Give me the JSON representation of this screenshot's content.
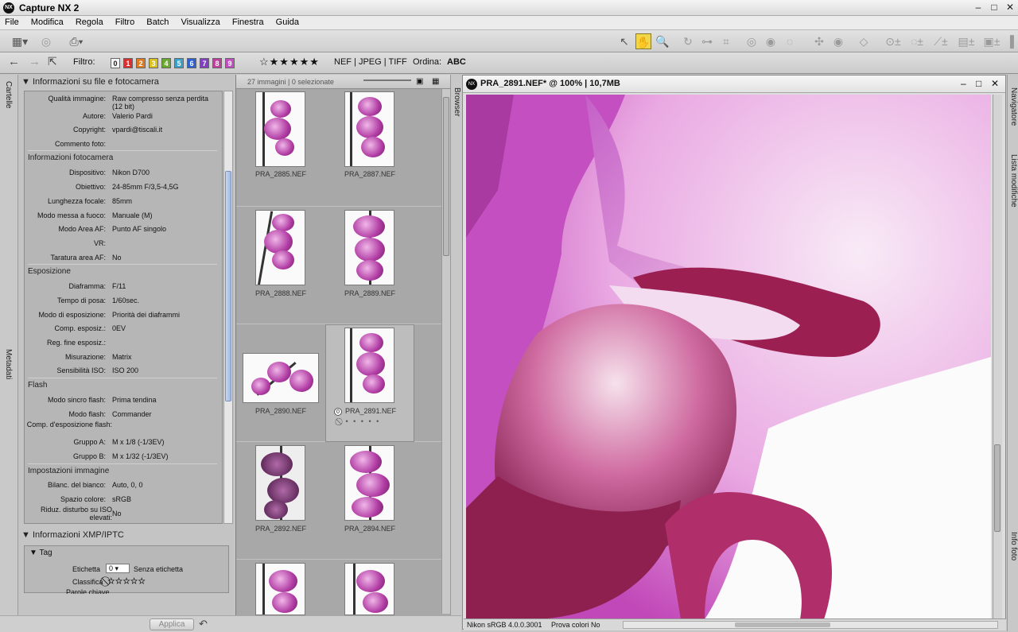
{
  "app": {
    "title": "Capture NX 2",
    "logo": "NX"
  },
  "menu": [
    "File",
    "Modifica",
    "Regola",
    "Filtro",
    "Batch",
    "Visualizza",
    "Finestra",
    "Guida"
  ],
  "toolbar2": {
    "filter_label": "Filtro:",
    "filter_values": [
      "0",
      "1",
      "2",
      "3",
      "4",
      "5",
      "6",
      "7",
      "8",
      "9"
    ],
    "filter_colors": [
      "#f4f4f4",
      "#d83030",
      "#e07a20",
      "#d8c020",
      "#6aa830",
      "#3aa0c8",
      "#3060d0",
      "#8040c0",
      "#c040a0",
      "#c050c0"
    ],
    "stars": "☆★★★★★",
    "formats": "NEF | JPEG | TIFF",
    "sort_label": "Ordina:",
    "sort_value": "ABC"
  },
  "side_tabs": {
    "left_top": "Cartelle",
    "left_bottom": "Metadati",
    "mid": "Browser",
    "right_top": "Navigatore",
    "right_mid": "Lista modifiche",
    "right_bottom": "Info foto"
  },
  "info": {
    "header": "Informazioni su file e fotocamera",
    "file_rows": [
      {
        "k": "Qualità immagine:",
        "v": "Raw compresso senza perdita (12 bit)"
      },
      {
        "k": "Autore:",
        "v": "Valerio Pardi"
      },
      {
        "k": "Copyright:",
        "v": "vpardi@tiscali.it"
      },
      {
        "k": "Commento foto:",
        "v": ""
      }
    ],
    "camera_title": "Informazioni fotocamera",
    "camera_rows": [
      {
        "k": "Dispositivo:",
        "v": "Nikon D700"
      },
      {
        "k": "Obiettivo:",
        "v": "24-85mm F/3,5-4,5G"
      },
      {
        "k": "Lunghezza focale:",
        "v": "85mm"
      },
      {
        "k": "Modo messa a fuoco:",
        "v": "Manuale (M)"
      },
      {
        "k": "Modo Area AF:",
        "v": "Punto AF singolo"
      },
      {
        "k": "VR:",
        "v": ""
      },
      {
        "k": "Taratura area AF:",
        "v": "No"
      }
    ],
    "exposure_title": "Esposizione",
    "exposure_rows": [
      {
        "k": "Diaframma:",
        "v": "F/11"
      },
      {
        "k": "Tempo di posa:",
        "v": "1/60sec."
      },
      {
        "k": "Modo di esposizione:",
        "v": "Priorità dei diaframmi"
      },
      {
        "k": "Comp. esposiz.:",
        "v": "0EV"
      },
      {
        "k": "Reg. fine esposiz.:",
        "v": ""
      },
      {
        "k": "Misurazione:",
        "v": "Matrix"
      },
      {
        "k": "Sensibilità ISO:",
        "v": "ISO 200"
      }
    ],
    "flash_title": "Flash",
    "flash_rows": [
      {
        "k": "Modo sincro flash:",
        "v": "Prima tendina"
      },
      {
        "k": "Modo flash:",
        "v": "Commander"
      },
      {
        "k": "Comp. d'esposizione flash:",
        "v": ""
      },
      {
        "k": "Gruppo A:",
        "v": "M x 1/8 (-1/3EV)"
      },
      {
        "k": "Gruppo B:",
        "v": "M x 1/32 (-1/3EV)"
      }
    ],
    "settings_title": "Impostazioni immagine",
    "settings_rows": [
      {
        "k": "Bilanc. del bianco:",
        "v": "Auto, 0, 0"
      },
      {
        "k": "Spazio colore:",
        "v": "sRGB"
      },
      {
        "k": "Riduz. disturbo su ISO elevati:",
        "v": "No"
      }
    ]
  },
  "xmp": {
    "header": "Informazioni XMP/IPTC",
    "tag_header": "Tag",
    "label_label": "Etichetta",
    "label_value": "0",
    "label_text": "Senza etichetta",
    "rating_label": "Classifica",
    "rating_stars": "⃠☆☆☆☆☆",
    "keyword_label": "Parole chiave",
    "apply_button": "Applica"
  },
  "browser": {
    "count": "27 immagini | 0 selezionate",
    "thumbs": [
      "PRA_2885.NEF",
      "PRA_2887.NEF",
      "PRA_2888.NEF",
      "PRA_2889.NEF",
      "PRA_2890.NEF",
      "PRA_2891.NEF",
      "PRA_2892.NEF",
      "PRA_2894.NEF",
      "",
      ""
    ],
    "selected_badge": "0",
    "selected_rating": "⃠ • • • • •"
  },
  "image_window": {
    "title": "PRA_2891.NEF* @ 100% | 10,7MB"
  },
  "status": {
    "profile": "Nikon sRGB 4.0.0.3001",
    "proof": "Prova colori No"
  }
}
